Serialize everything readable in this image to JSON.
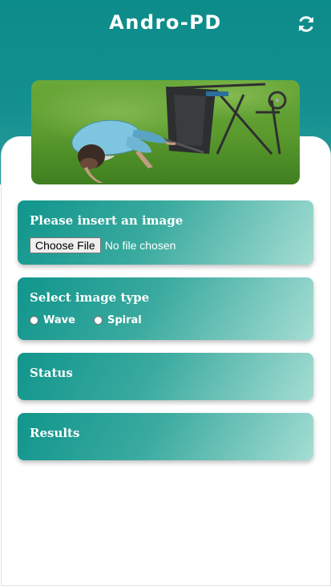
{
  "header": {
    "title": "Andro-PD",
    "refresh_icon": "refresh-icon"
  },
  "hero_image": {
    "subject": "fallen-person-with-walker-on-grass"
  },
  "cards": {
    "upload": {
      "title": "Please insert an image",
      "button_label": "Choose File",
      "file_status": "No file chosen"
    },
    "image_type": {
      "title": "Select image type",
      "options": [
        "Wave",
        "Spiral"
      ]
    },
    "status": {
      "title": "Status"
    },
    "results": {
      "title": "Results"
    }
  },
  "colors": {
    "header_teal": "#0c8c8a",
    "card_gradient_start": "#10958c",
    "card_gradient_end": "#a5ddd3",
    "text_white": "#ffffff"
  }
}
